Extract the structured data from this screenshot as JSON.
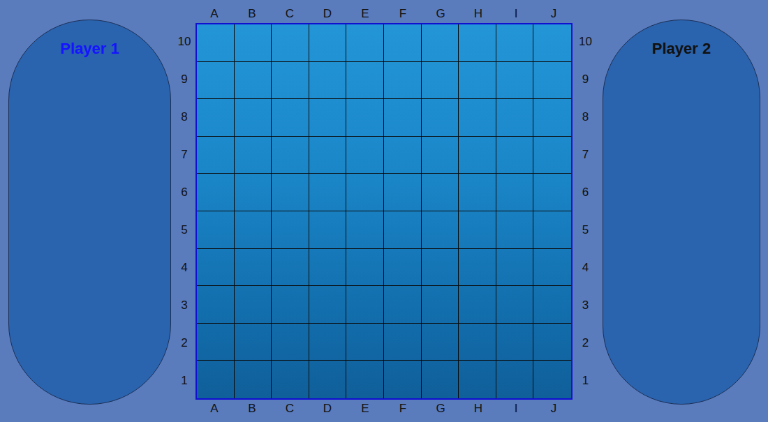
{
  "players": [
    {
      "name": "Player 1",
      "selected": true
    },
    {
      "name": "Player 2",
      "selected": false
    }
  ],
  "board": {
    "columns": [
      "A",
      "B",
      "C",
      "D",
      "E",
      "F",
      "G",
      "H",
      "I",
      "J"
    ],
    "rows": [
      "10",
      "9",
      "8",
      "7",
      "6",
      "5",
      "4",
      "3",
      "2",
      "1"
    ]
  }
}
